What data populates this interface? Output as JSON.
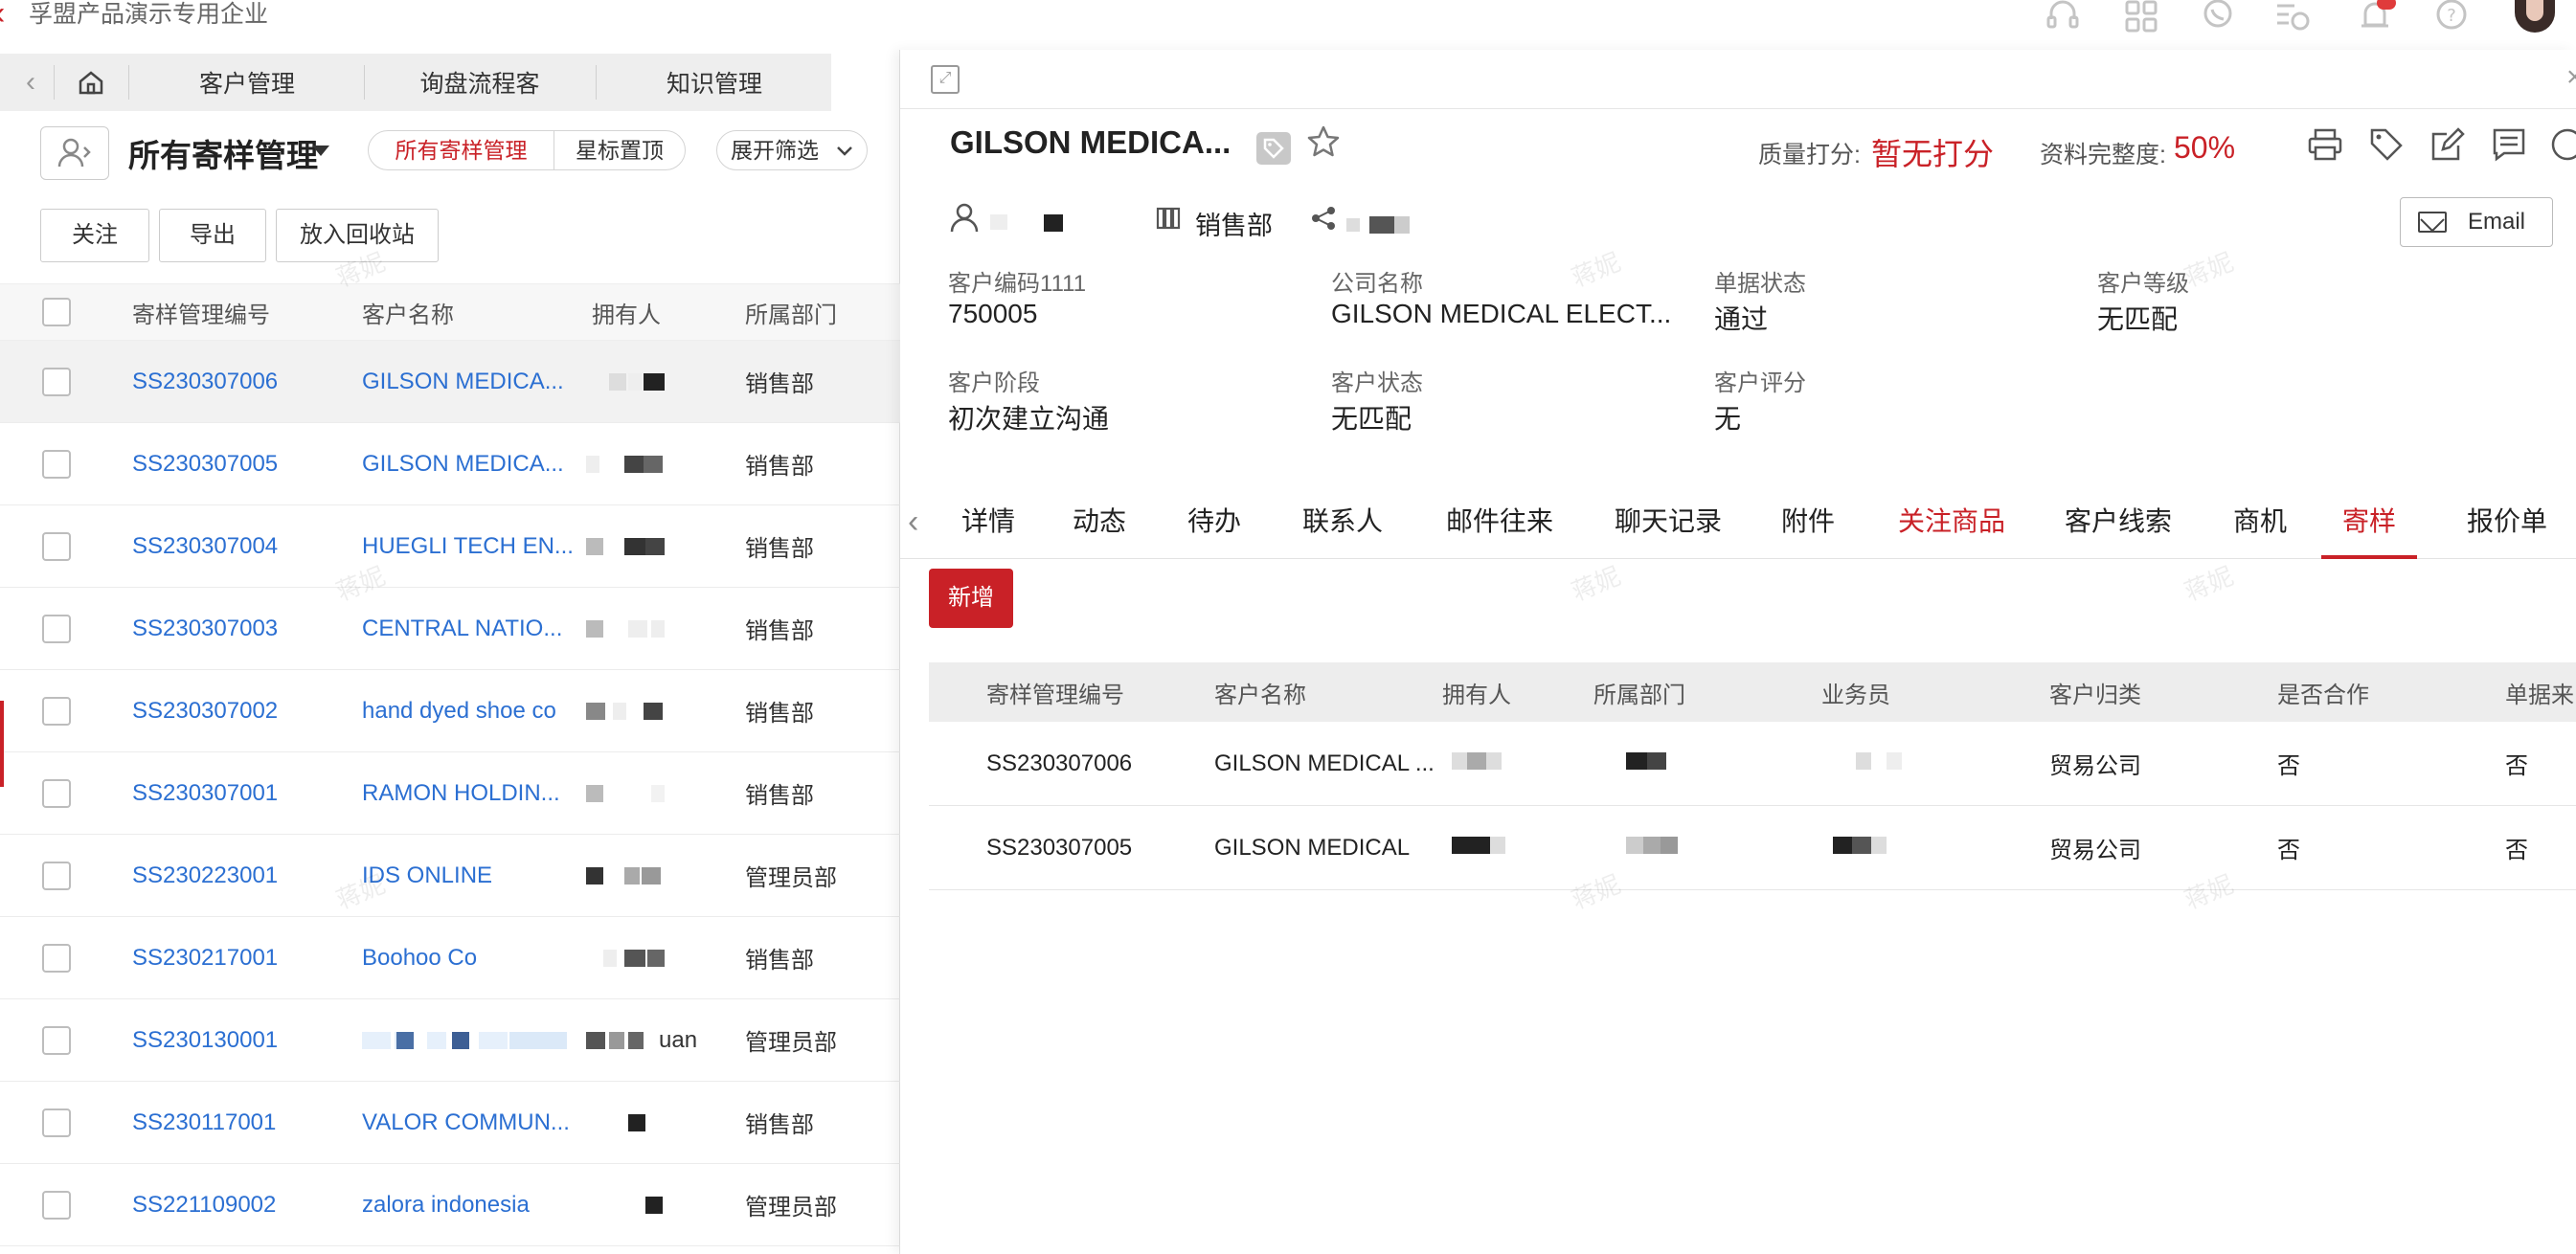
{
  "topbar": {
    "company_name": "孚盟产品演示专用企业",
    "icons": [
      "headset-icon",
      "apps-grid-icon",
      "chat-icon",
      "history-icon",
      "bell-icon",
      "help-icon"
    ]
  },
  "nav_tabs": [
    {
      "label": "客户管理"
    },
    {
      "label": "询盘流程客"
    },
    {
      "label": "知识管理"
    }
  ],
  "view": {
    "title": "所有寄样管理",
    "segments": [
      {
        "label": "所有寄样管理"
      },
      {
        "label": "星标置顶"
      }
    ],
    "expand_filter": "展开筛选"
  },
  "actions": {
    "follow": "关注",
    "export": "导出",
    "recycle": "放入回收站"
  },
  "list": {
    "columns": [
      "寄样管理编号",
      "客户名称",
      "拥有人",
      "所属部门"
    ],
    "rows": [
      {
        "code": "SS230307006",
        "customer": "GILSON MEDICA...",
        "owner_suffix": "",
        "dept": "销售部"
      },
      {
        "code": "SS230307005",
        "customer": "GILSON MEDICA...",
        "owner_suffix": "",
        "dept": "销售部"
      },
      {
        "code": "SS230307004",
        "customer": "HUEGLI TECH EN...",
        "owner_suffix": "",
        "dept": "销售部"
      },
      {
        "code": "SS230307003",
        "customer": "CENTRAL NATIO...",
        "owner_suffix": "",
        "dept": "销售部"
      },
      {
        "code": "SS230307002",
        "customer": "hand dyed shoe co",
        "owner_suffix": "",
        "dept": "销售部"
      },
      {
        "code": "SS230307001",
        "customer": "RAMON HOLDIN...",
        "owner_suffix": "",
        "dept": "销售部"
      },
      {
        "code": "SS230223001",
        "customer": "IDS ONLINE",
        "owner_suffix": "",
        "dept": "管理员部"
      },
      {
        "code": "SS230217001",
        "customer": "Boohoo Co",
        "owner_suffix": "",
        "dept": "销售部"
      },
      {
        "code": "SS230130001",
        "customer": "",
        "owner_suffix": "uan",
        "dept": "管理员部"
      },
      {
        "code": "SS230117001",
        "customer": "VALOR COMMUN...",
        "owner_suffix": "",
        "dept": "销售部"
      },
      {
        "code": "SS221109002",
        "customer": "zalora indonesia",
        "owner_suffix": "",
        "dept": "管理员部"
      }
    ]
  },
  "detail": {
    "title": "GILSON MEDICA...",
    "quality_label": "质量打分:",
    "quality_value": "暂无打分",
    "completeness_label": "资料完整度:",
    "completeness_value": "50%",
    "email_button": "Email",
    "department": "销售部",
    "fields": [
      {
        "label": "客户编码1111",
        "value": "750005"
      },
      {
        "label": "公司名称",
        "value": "GILSON MEDICAL ELECT..."
      },
      {
        "label": "单据状态",
        "value": "通过"
      },
      {
        "label": "客户等级",
        "value": "无匹配"
      },
      {
        "label": "客户阶段",
        "value": "初次建立沟通"
      },
      {
        "label": "客户状态",
        "value": "无匹配"
      },
      {
        "label": "客户评分",
        "value": "无"
      }
    ],
    "tabs": [
      {
        "label": "详情"
      },
      {
        "label": "动态"
      },
      {
        "label": "待办"
      },
      {
        "label": "联系人"
      },
      {
        "label": "邮件往来"
      },
      {
        "label": "聊天记录"
      },
      {
        "label": "附件"
      },
      {
        "label": "关注商品"
      },
      {
        "label": "客户线索"
      },
      {
        "label": "商机"
      },
      {
        "label": "寄样"
      },
      {
        "label": "报价单"
      }
    ],
    "active_tab": "寄样",
    "new_button": "新增",
    "sub_table": {
      "columns": [
        "寄样管理编号",
        "客户名称",
        "拥有人",
        "所属部门",
        "业务员",
        "客户归类",
        "是否合作",
        "单据来"
      ],
      "rows": [
        {
          "code": "SS230307006",
          "customer": "GILSON MEDICAL ...",
          "category": "贸易公司",
          "cooperate": "否",
          "source": "否"
        },
        {
          "code": "SS230307005",
          "customer": "GILSON MEDICAL",
          "category": "贸易公司",
          "cooperate": "否",
          "source": "否"
        }
      ]
    }
  },
  "watermark_text": "蒋妮",
  "colors": {
    "accent": "#c92127",
    "link": "#2b6fd2"
  }
}
